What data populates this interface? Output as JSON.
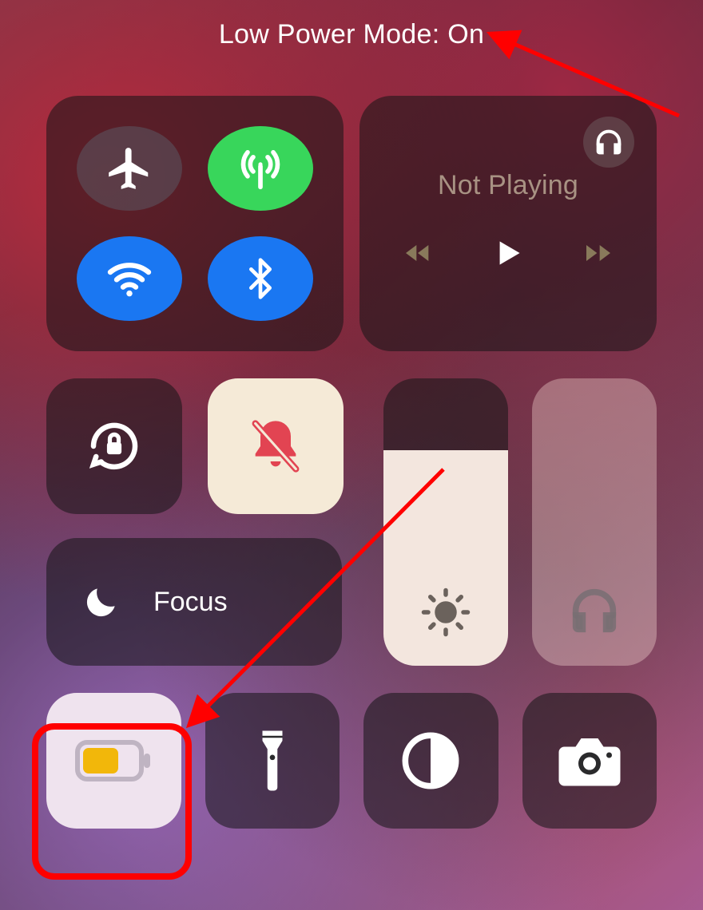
{
  "status": {
    "label": "Low Power Mode: On"
  },
  "connectivity": {
    "airplane": {
      "active": false
    },
    "cellular": {
      "active": true
    },
    "wifi": {
      "active": true
    },
    "bluetooth": {
      "active": true
    }
  },
  "media": {
    "title": "Not Playing",
    "airplay_icon": "headphones-icon"
  },
  "smalltiles": {
    "orientation_lock": {
      "active": false
    },
    "silent": {
      "active": true
    }
  },
  "focus": {
    "label": "Focus"
  },
  "sliders": {
    "brightness": {
      "percent": 75,
      "icon": "sun-icon"
    },
    "volume": {
      "percent": 0,
      "icon": "headphones-icon"
    }
  },
  "bottom": {
    "low_power": {
      "active": true,
      "highlighted": true
    },
    "flashlight": {
      "active": false
    },
    "darkmode": {
      "active": false
    },
    "camera": {
      "active": false
    }
  },
  "colors": {
    "green": "#38d65b",
    "blue": "#1a77f2",
    "red": "#e24452",
    "yellow": "#f2b70a",
    "annotation": "#ff0000"
  }
}
